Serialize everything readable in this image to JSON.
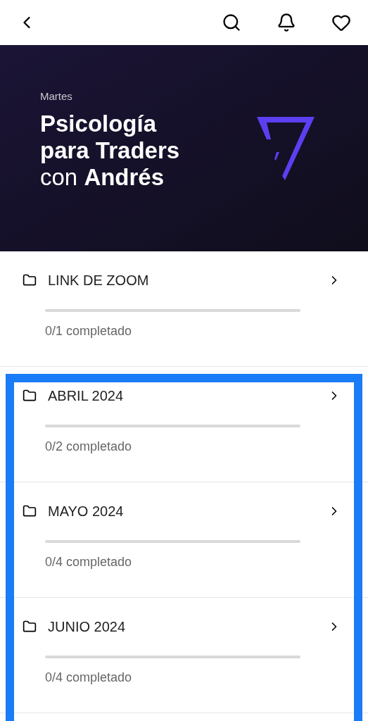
{
  "banner": {
    "day": "Martes",
    "title": "**Psicología**\n**para Traders**\ncon **Andrés**"
  },
  "modules": [
    {
      "title": "LINK DE ZOOM",
      "level": 0,
      "progress": "0/1 completado"
    },
    {
      "title": "ABRIL 2024",
      "level": 0,
      "progress": "0/2 completado"
    },
    {
      "title": "MAYO 2024",
      "level": 0,
      "progress": "0/4 completado"
    },
    {
      "title": "JUNIO 2024",
      "level": 0,
      "progress": "0/4 completado"
    }
  ]
}
